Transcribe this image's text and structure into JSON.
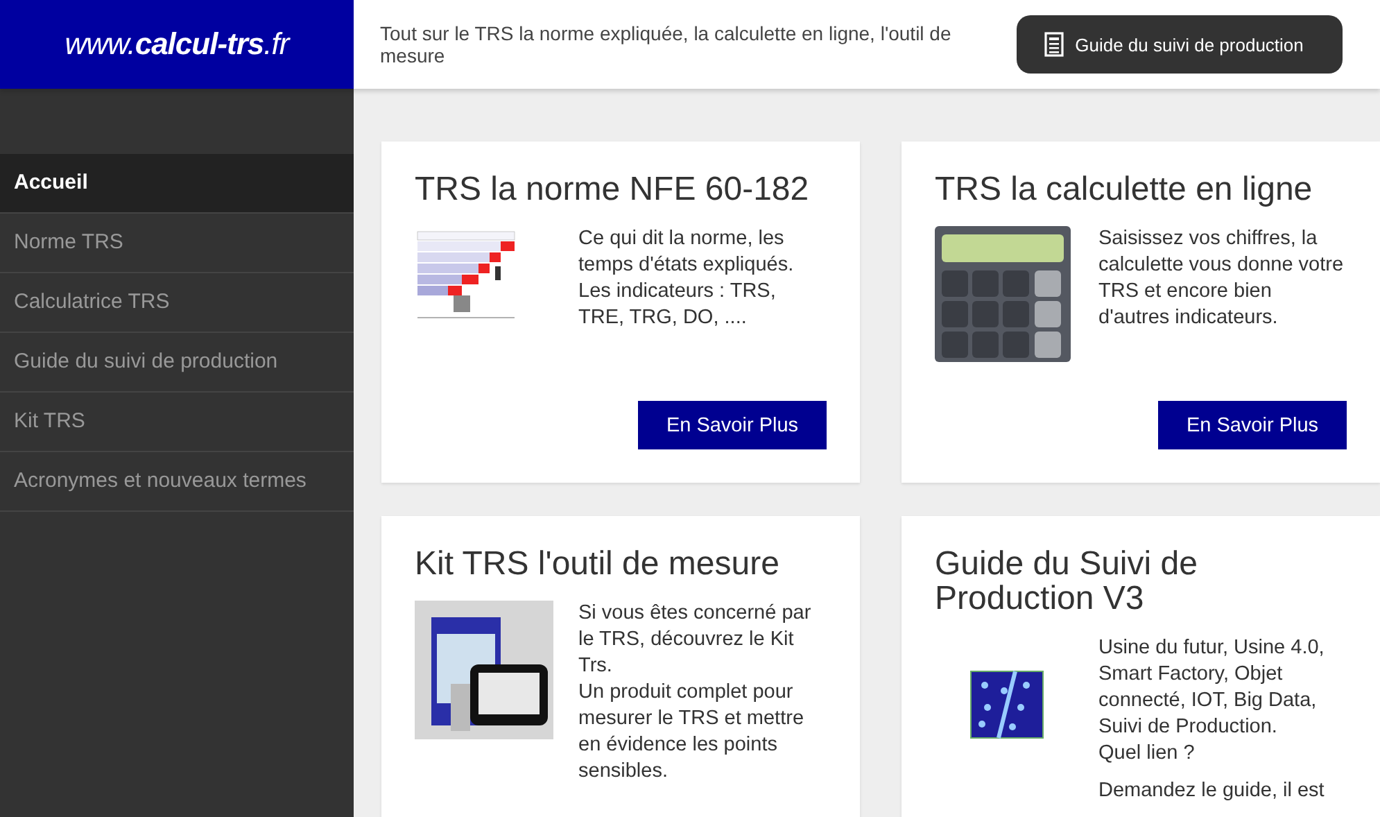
{
  "header": {
    "logo": {
      "prefix": "www.",
      "brand": "calcul-trs",
      "suffix": ".fr"
    },
    "tagline": "Tout sur le TRS la norme expliquée, la calculette en ligne, l'outil de mesure",
    "guide_button": "Guide du suivi de production"
  },
  "sidebar": {
    "items": [
      {
        "label": "Accueil",
        "selected": true
      },
      {
        "label": "Norme TRS",
        "selected": false
      },
      {
        "label": "Calculatrice TRS",
        "selected": false
      },
      {
        "label": "Guide du suivi de production",
        "selected": false
      },
      {
        "label": "Kit TRS",
        "selected": false
      },
      {
        "label": "Acronymes et nouveaux termes",
        "selected": false
      }
    ]
  },
  "cards": [
    {
      "kind": "norme",
      "title": "TRS la norme NFE 60-182",
      "paragraphs": [
        "Ce qui dit la norme, les temps d'états expliqués. Les indicateurs : TRS, TRE, TRG, DO, ...."
      ],
      "button": "En Savoir Plus"
    },
    {
      "kind": "calculator",
      "title": "TRS la calculette en ligne",
      "paragraphs": [
        "Saisissez vos chiffres, la calculette vous donne votre TRS et encore bien d'autres indicateurs."
      ],
      "button": "En Savoir Plus"
    },
    {
      "kind": "kit",
      "title": "Kit TRS l'outil de mesure",
      "paragraphs": [
        "Si vous êtes concerné par le TRS, découvrez le Kit Trs.",
        "Un produit complet pour mesurer le TRS et mettre en évidence les points sensibles."
      ]
    },
    {
      "kind": "guide",
      "title": "Guide du Suivi de Production V3",
      "paragraphs": [
        "Usine du futur, Usine 4.0, Smart Factory, Objet connecté, IOT, Big Data, Suivi de Production.",
        "Quel lien ?",
        "Demandez le guide, il est"
      ]
    }
  ]
}
